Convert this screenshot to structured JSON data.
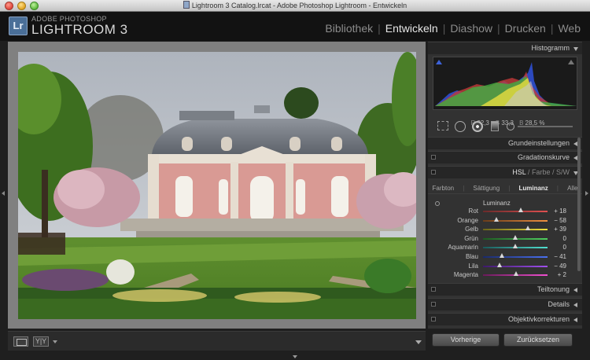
{
  "window": {
    "title": "Lightroom 3 Catalog.lrcat - Adobe Photoshop Lightroom - Entwickeln"
  },
  "header": {
    "logo_text": "Lr",
    "brand_small": "ADOBE PHOTOSHOP",
    "brand_big": "LIGHTROOM 3",
    "modules": [
      "Bibliothek",
      "Entwickeln",
      "Diashow",
      "Drucken",
      "Web"
    ],
    "active_module": "Entwickeln"
  },
  "histogram": {
    "label": "Histogramm",
    "readout": {
      "r_label": "R",
      "r": "32,3",
      "g_label": "G",
      "g": "33,3",
      "b_label": "B",
      "b": "28,5",
      "unit": "%"
    }
  },
  "panels": {
    "grundeinstellungen": "Grundeinstellungen",
    "gradationskurve": "Gradationskurve",
    "hsl": {
      "hsl": "HSL",
      "farbe": "Farbe",
      "sw": "S/W",
      "sep": "/"
    },
    "teiltonung": "Teiltonung",
    "details": "Details",
    "objektivkorrekturen": "Objektivkorrekturen"
  },
  "hsl_subtabs": [
    "Farbton",
    "Sättigung",
    "Luminanz",
    "Alle"
  ],
  "hsl_active_subtab": "Luminanz",
  "luminanz": {
    "title": "Luminanz",
    "sliders": [
      {
        "name": "Rot",
        "value": "+ 18",
        "n": 18,
        "colors": [
          "#6a2a2a",
          "#e05050"
        ]
      },
      {
        "name": "Orange",
        "value": "− 58",
        "n": -58,
        "colors": [
          "#6a3c1a",
          "#f09040"
        ]
      },
      {
        "name": "Gelb",
        "value": "+ 39",
        "n": 39,
        "colors": [
          "#6a6418",
          "#f0e040"
        ]
      },
      {
        "name": "Grün",
        "value": "0",
        "n": 0,
        "colors": [
          "#1c5a20",
          "#50d060"
        ]
      },
      {
        "name": "Aquamarin",
        "value": "0",
        "n": 0,
        "colors": [
          "#1a5a5a",
          "#50e0d0"
        ]
      },
      {
        "name": "Blau",
        "value": "− 41",
        "n": -41,
        "colors": [
          "#1a2a6a",
          "#4a70f0"
        ]
      },
      {
        "name": "Lila",
        "value": "− 49",
        "n": -49,
        "colors": [
          "#3e1a6a",
          "#a050f0"
        ]
      },
      {
        "name": "Magenta",
        "value": "+ 2",
        "n": 2,
        "colors": [
          "#6a1a5a",
          "#f050d0"
        ]
      }
    ]
  },
  "buttons": {
    "previous": "Vorherige",
    "reset": "Zurücksetzen"
  },
  "toolbar": {
    "yy_label": "Y|Y"
  }
}
